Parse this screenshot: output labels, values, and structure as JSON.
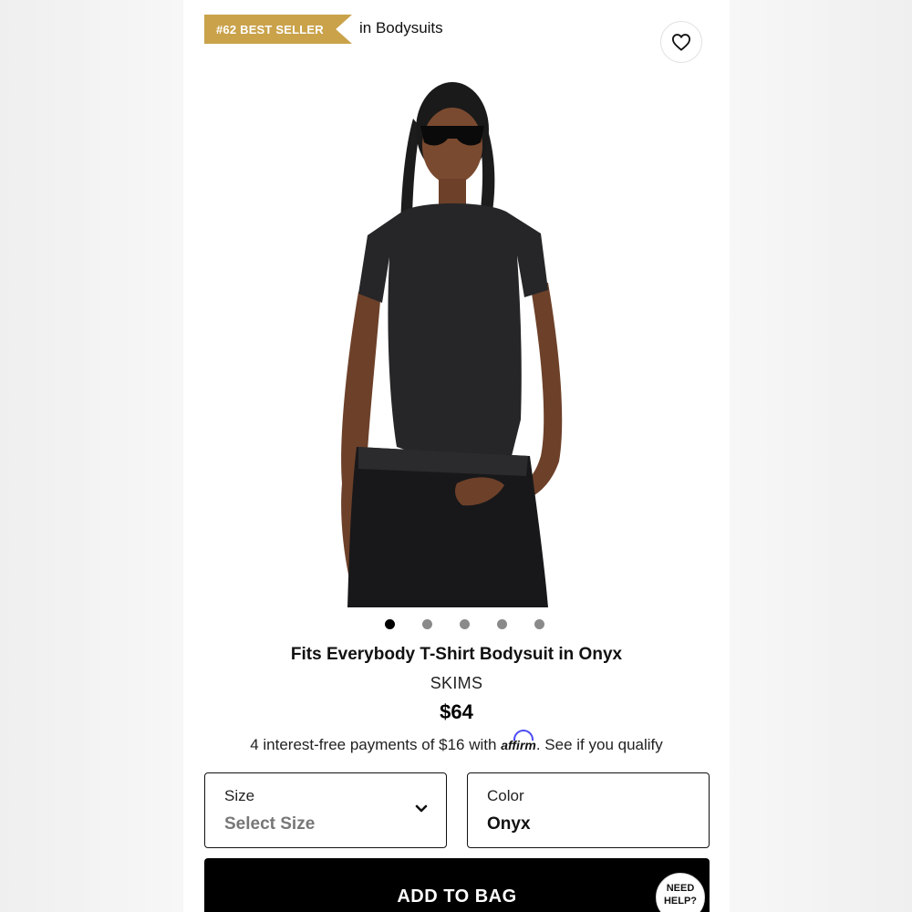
{
  "badge": {
    "rank_label": "#62 BEST SELLER",
    "color": "#c9a24a"
  },
  "category": "in Bodysuits",
  "wishlist_icon": "heart-icon",
  "carousel": {
    "total": 5,
    "active_index": 0
  },
  "product": {
    "title": "Fits Everybody T-Shirt Bodysuit in Onyx",
    "brand": "SKIMS",
    "price": "$64"
  },
  "financing": {
    "prefix": "4 interest-free payments of $16 with",
    "provider": "affirm",
    "link_text": ". See if you qualify"
  },
  "size_select": {
    "label": "Size",
    "value": "Select Size",
    "icon": "chevron-down-icon"
  },
  "color_select": {
    "label": "Color",
    "value": "Onyx"
  },
  "add_to_bag": {
    "label": "ADD TO BAG"
  },
  "help": {
    "line1": "NEED",
    "line2": "HELP?"
  }
}
